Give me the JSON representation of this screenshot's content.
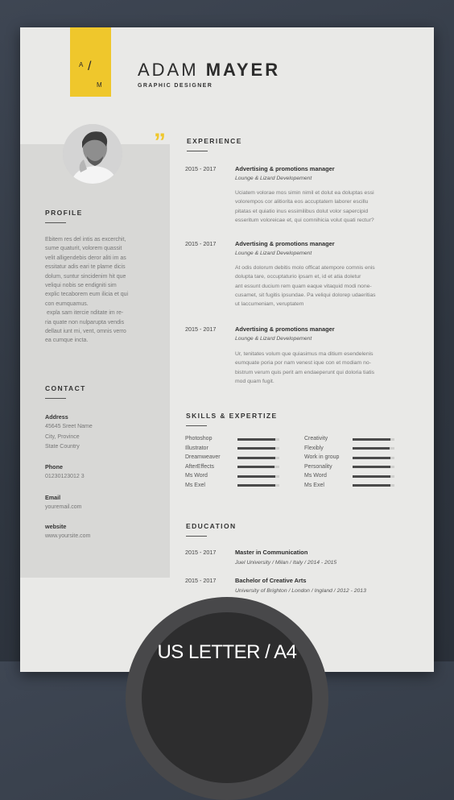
{
  "monogram": {
    "first": "A",
    "slash": "/",
    "second": "M"
  },
  "header": {
    "first_name": "ADAM",
    "last_name": "MAYER",
    "title": "GRAPHIC DESIGNER"
  },
  "quote_mark": "”",
  "profile": {
    "heading": "PROFILE",
    "lines": [
      "Ebitem res del intis as excerchit,",
      "sume quaturit, volorem quassit",
      "velit alligendebis deror aliti im as",
      "essitatur adis eari te plame dicis",
      "dolum, suntur sincidenim hit que",
      "veliqui nobis se endigniti sim",
      "explic tecaborem eum ilicia et qui",
      "con eumquamus.",
      " expla sam itercie nditate im re-",
      "ria quate non nulparupta vendis",
      "dellaut iunt mi, vent, omnis verro",
      "ea cumque incta."
    ]
  },
  "contact": {
    "heading": "CONTACT",
    "address_label": "Address",
    "address_lines": [
      "45645 Sreet Name",
      "City, Province",
      "State Country"
    ],
    "phone_label": "Phone",
    "phone": "01230123012 3",
    "email_label": "Email",
    "email": "youremail.com",
    "website_label": "website",
    "website": "www.yoursite.com"
  },
  "experience": {
    "heading": "EXPERIENCE",
    "items": [
      {
        "years": "2015 - 2017",
        "title": "Advertising & promotions manager",
        "company": "Lounge & Lizard Developement",
        "desc": [
          "Uciatem volorae mos simin nimil et dolut ea doluptas essi",
          "volorempos cor alitiorita eos accuptatem laborer escillu",
          "pitatas et quiatio inus essimilibus dolut volor sapercipid",
          "esseritum voloreicae et, qui comnihicia volut quati rectur?"
        ]
      },
      {
        "years": "2015 - 2017",
        "title": "Advertising & promotions manager",
        "company": "Lounge & Lizard Developement",
        "desc": [
          "At odis dolorum debitis molo officat atempore comnis enis",
          "dolupta tare, occuptaturio ipsam et, id et atia doletur",
          "ant essunt ducium rem quam eaque vitaquid modi none-",
          "cusamet, sit fugitis ipsundae. Pa veliqui dolorep udaeritias",
          "ut laccumeniam, veruptatem"
        ]
      },
      {
        "years": "2015 - 2017",
        "title": "Advertising & promotions manager",
        "company": "Lounge & Lizard Developement",
        "desc": [
          "Ur, tenitates volum que quiasimus ma ditium esendelenis",
          "eumquate poria por nam venest ique con et modiam no-",
          "bistrum verum quis perit am endaeperunt qui doloria tiatis",
          "mod quam fugit."
        ]
      }
    ]
  },
  "skills": {
    "heading": "SKILLS & EXPERTIZE",
    "left": [
      {
        "name": "Photoshop",
        "level": 0.9
      },
      {
        "name": "Illustrator",
        "level": 0.9
      },
      {
        "name": "Dreamweaver",
        "level": 0.9
      },
      {
        "name": "AfterEffects",
        "level": 0.88
      },
      {
        "name": "Ms Word",
        "level": 0.9
      },
      {
        "name": "Ms Exel",
        "level": 0.9
      }
    ],
    "right": [
      {
        "name": "Creativity",
        "level": 0.9
      },
      {
        "name": "Flexibly",
        "level": 0.88
      },
      {
        "name": "Work in group",
        "level": 0.9
      },
      {
        "name": "Personality",
        "level": 0.9
      },
      {
        "name": "Ms Word",
        "level": 0.9
      },
      {
        "name": "Ms Exel",
        "level": 0.9
      }
    ]
  },
  "education": {
    "heading": "EDUCATION",
    "items": [
      {
        "years": "2015 - 2017",
        "degree": "Master in Communication",
        "school": "Juel University / Milan / Italy / 2014 - 2015"
      },
      {
        "years": "2015 - 2017",
        "degree": "Bachelor of Creative Arts",
        "school": "University of Brighton / London / Ingland / 2012 - 2013"
      }
    ]
  },
  "badge": {
    "text": "US LETTER / A4"
  },
  "colors": {
    "accent": "#efc72c",
    "background": "#343b45",
    "paper": "#e9e9e7"
  }
}
